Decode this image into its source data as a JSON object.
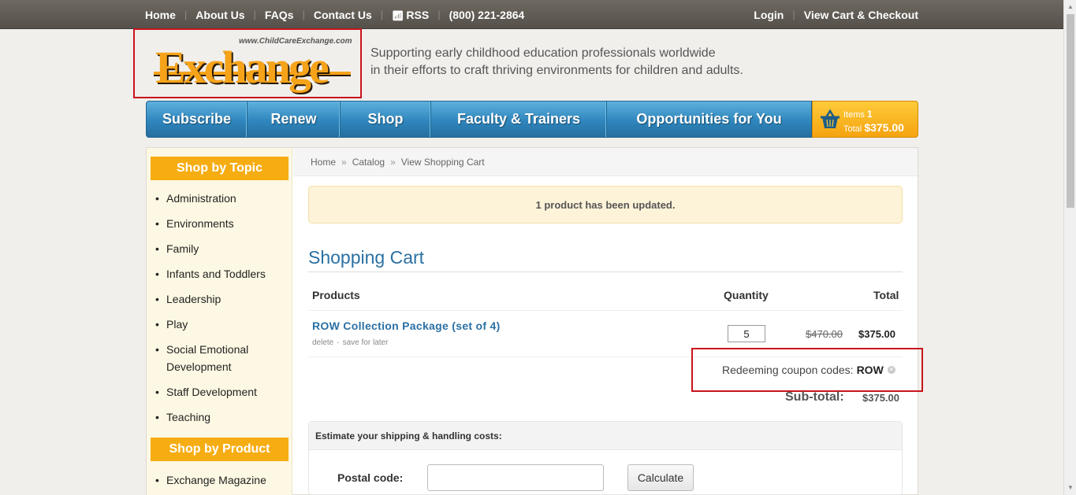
{
  "topbar": {
    "links": [
      "Home",
      "About Us",
      "FAQs",
      "Contact Us",
      "RSS",
      "(800) 221-2864"
    ],
    "login": "Login",
    "view_cart": "View Cart & Checkout"
  },
  "header": {
    "logo_url_text": "www.ChildCareExchange.com",
    "logo_word": "Exchange",
    "tagline_line1": "Supporting early childhood education professionals worldwide",
    "tagline_line2": "in their efforts to craft thriving environments for children and adults."
  },
  "nav": {
    "items": [
      "Subscribe",
      "Renew",
      "Shop",
      "Faculty & Trainers",
      "Opportunities for You"
    ]
  },
  "cart_summary": {
    "items_label": "Items",
    "items_count": "1",
    "total_label": "Total",
    "total_value": "$375.00"
  },
  "sidebar": {
    "topic_heading": "Shop by Topic",
    "topics": [
      "Administration",
      "Environments",
      "Family",
      "Infants and Toddlers",
      "Leadership",
      "Play",
      "Social Emotional Development",
      "Staff Development",
      "Teaching"
    ],
    "product_heading": "Shop by Product",
    "products": [
      "Exchange Magazine"
    ]
  },
  "breadcrumb": [
    "Home",
    "Catalog",
    "View Shopping Cart"
  ],
  "message": "1 product has been updated.",
  "cart": {
    "title": "Shopping Cart",
    "headers": {
      "products": "Products",
      "quantity": "Quantity",
      "total": "Total"
    },
    "item": {
      "name": "ROW Collection Package (set of 4)",
      "delete": "delete",
      "save": "save for later",
      "quantity": "5",
      "old_price": "$470.00",
      "price": "$375.00"
    },
    "coupon_label": "Redeeming coupon codes:",
    "coupon_code": "ROW",
    "subtotal_label": "Sub-total:",
    "subtotal_value": "$375.00"
  },
  "shipping": {
    "heading": "Estimate your shipping & handling costs:",
    "postal_label": "Postal code:",
    "postal_value": "",
    "calculate_label": "Calculate"
  },
  "colors": {
    "accent_blue": "#2b70a3",
    "nav_blue": "#2f86bd",
    "orange": "#f6ad12",
    "highlight_red": "#c8141c"
  }
}
